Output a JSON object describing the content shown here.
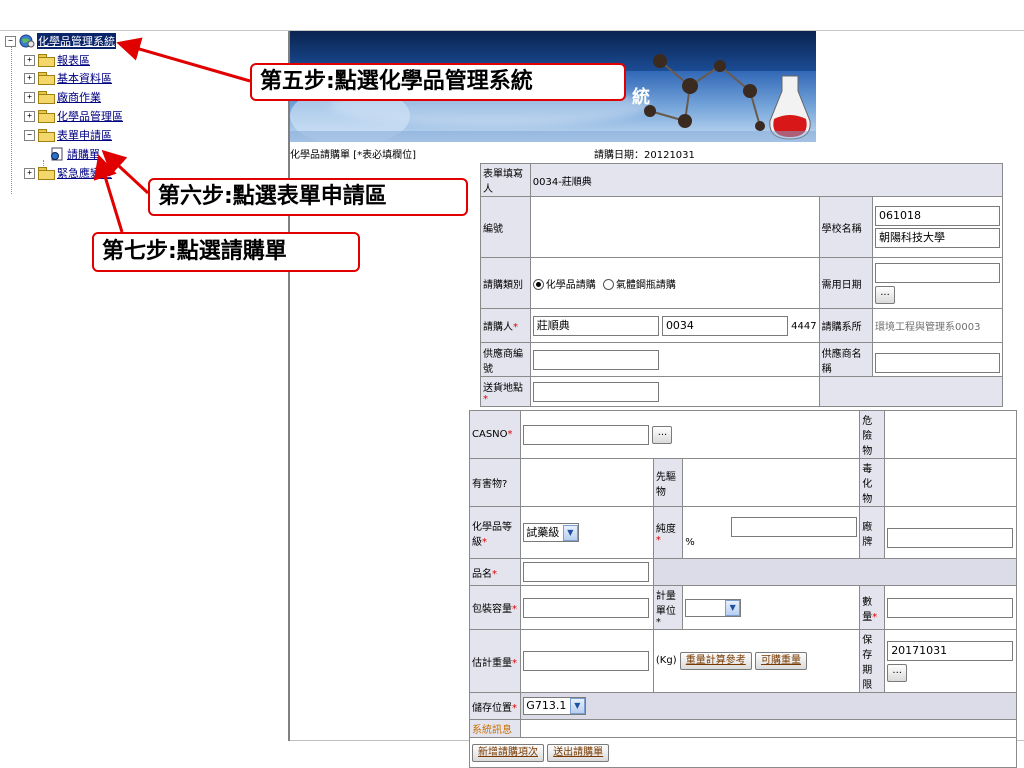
{
  "tree": {
    "root_label": "化學品管理系統",
    "items": [
      {
        "label": "報表區"
      },
      {
        "label": "基本資料區"
      },
      {
        "label": "廠商作業"
      },
      {
        "label": "化學品管理區"
      },
      {
        "label": "表單申請區"
      },
      {
        "label": "請購單"
      },
      {
        "label": "緊急應變區"
      }
    ]
  },
  "banner": {
    "partial_title": "統"
  },
  "form": {
    "title": "化學品請購單 [*表必填欄位]",
    "date_label": "請購日期：",
    "date_value": "20121031",
    "filler_label": "表單填寫人",
    "filler_value": "0034-莊順典",
    "number_label": "編號",
    "school_label": "學校名稱",
    "school_code": "061018",
    "school_name": "朝陽科技大學",
    "category_label": "請購類別",
    "category_option1": "化學品請購",
    "category_option2": "氣體鋼瓶請購",
    "need_date_label": "需用日期",
    "requester_label": "請購人",
    "requester_name": "莊順典",
    "requester_id": "0034",
    "requester_ext": "4447",
    "dept_label": "請購系所",
    "dept_value": "環境工程與管理系0003",
    "supplier_no_label": "供應商編號",
    "supplier_name_label": "供應商名稱",
    "delivery_label": "送貨地點",
    "required_mark": "*",
    "dots_label": "..."
  },
  "detail": {
    "casno_label": "CASNO",
    "dangerous_label": "危險物",
    "harmful_label": "有害物?",
    "precursor_label": "先驅物",
    "toxic_label": "毒化物",
    "grade_label": "化學品等級",
    "grade_value": "試藥級",
    "purity_label": "純度",
    "purity_unit": "%",
    "brand_label": "廠牌",
    "name_label": "品名",
    "package_label": "包裝容量",
    "unit_label": "計量單位",
    "qty_label": "數量",
    "weight_label": "估計重量",
    "weight_unit": "(Kg)",
    "weight_ref_button": "重量計算參考",
    "buyable_weight_button": "可購重量",
    "shelf_life_label": "保存期限",
    "shelf_life_value": "20171031",
    "storage_label": "儲存位置",
    "storage_value": "G713.1",
    "sysmsg_label": "系統訊息",
    "add_item_button": "新增請購項次",
    "submit_button": "送出請購單"
  },
  "callouts": {
    "step5": "第五步:點選化學品管理系統",
    "step6": "第六步:點選表單申請區",
    "step7": "第七步:點選請購單"
  },
  "colors": {
    "callout_border": "#e00000",
    "arrow": "#e00000",
    "tree_link": "#000080",
    "selected_bg": "#0a246a"
  }
}
